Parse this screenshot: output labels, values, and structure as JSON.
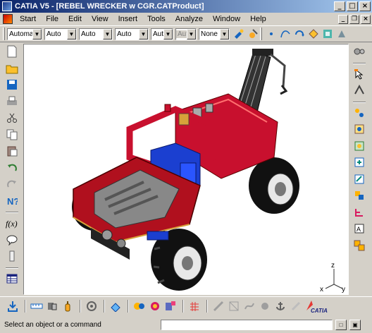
{
  "window": {
    "title": "CATIA V5 - [REBEL WRECKER w CGR.CATProduct]"
  },
  "menu": {
    "items": [
      "Start",
      "File",
      "Edit",
      "View",
      "Insert",
      "Tools",
      "Analyze",
      "Window",
      "Help"
    ]
  },
  "toolbar": {
    "combos": [
      {
        "value": "Automa",
        "disabled": false
      },
      {
        "value": "Auto",
        "disabled": false
      },
      {
        "value": "Auto",
        "disabled": false
      },
      {
        "value": "Auto",
        "disabled": false
      },
      {
        "value": "Aut",
        "disabled": false
      },
      {
        "value": "Aut",
        "disabled": true
      },
      {
        "value": "None",
        "disabled": false
      }
    ]
  },
  "status": {
    "prompt": "Select an object or a command",
    "command_value": ""
  },
  "viewport": {
    "background": "#ffffff",
    "model": "red lego tow truck",
    "axis_labels": [
      "z",
      "x",
      "y"
    ]
  },
  "brand": {
    "logo_text": "CATIA"
  },
  "colors": {
    "title_start": "#0a246a",
    "title_end": "#a6caf0",
    "model_red": "#c8102e",
    "model_blue": "#1b3fd0"
  }
}
